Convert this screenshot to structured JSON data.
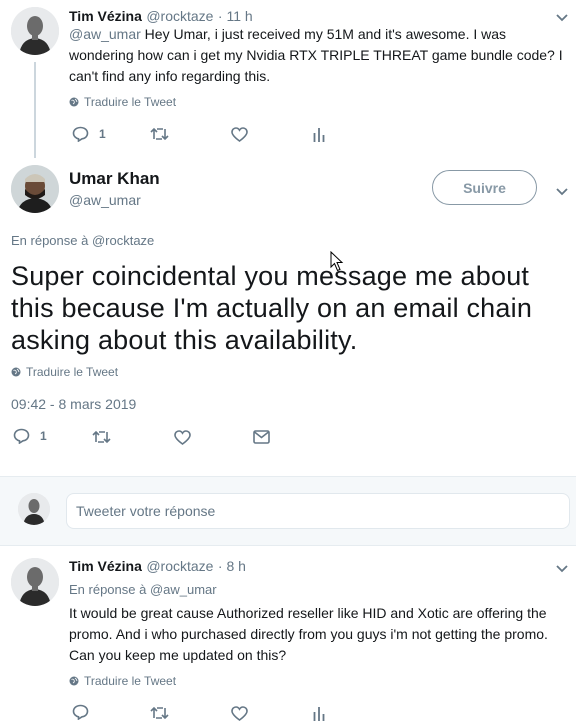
{
  "tweet1": {
    "name": "Tim Vézina",
    "handle": "@rocktaze",
    "time": "· 11 h",
    "mention": "@aw_umar",
    "text": " Hey Umar, i just received my 51M and it's awesome. I was wondering how can i get my Nvidia RTX TRIPLE THREAT game bundle code? I can't find any info regarding this.",
    "translate": "Traduire le Tweet",
    "reply_count": "1",
    "icons": [
      "reply-icon",
      "retweet-icon",
      "like-icon",
      "analytics-icon"
    ]
  },
  "main_tweet": {
    "name": "Umar Khan",
    "handle": "@aw_umar",
    "follow_label": "Suivre",
    "reply_to_prefix": "En réponse à ",
    "reply_to_handle": "@rocktaze",
    "text": "Super coincidental you message me about this because  I'm actually on an email chain asking about this availability.",
    "translate": "Traduire le Tweet",
    "timestamp": "09:42 - 8 mars 2019",
    "reply_count": "1",
    "icons": [
      "reply-icon",
      "retweet-icon",
      "like-icon",
      "message-icon"
    ]
  },
  "reply_composer": {
    "placeholder": "Tweeter votre réponse"
  },
  "tweet3": {
    "name": "Tim Vézina",
    "handle": "@rocktaze",
    "time": "· 8 h",
    "reply_to_prefix": "En réponse à ",
    "reply_to_handle": "@aw_umar",
    "text": "It would be great cause Authorized reseller like HID and Xotic are offering the promo. And i who purchased directly from you guys i'm not getting the promo. Can you keep me updated on this?",
    "translate": "Traduire le Tweet",
    "icons": [
      "reply-icon",
      "retweet-icon",
      "like-icon",
      "analytics-icon"
    ]
  },
  "colors": {
    "text": "#14171a",
    "secondary": "#657786",
    "divider": "#e6ecf0"
  }
}
